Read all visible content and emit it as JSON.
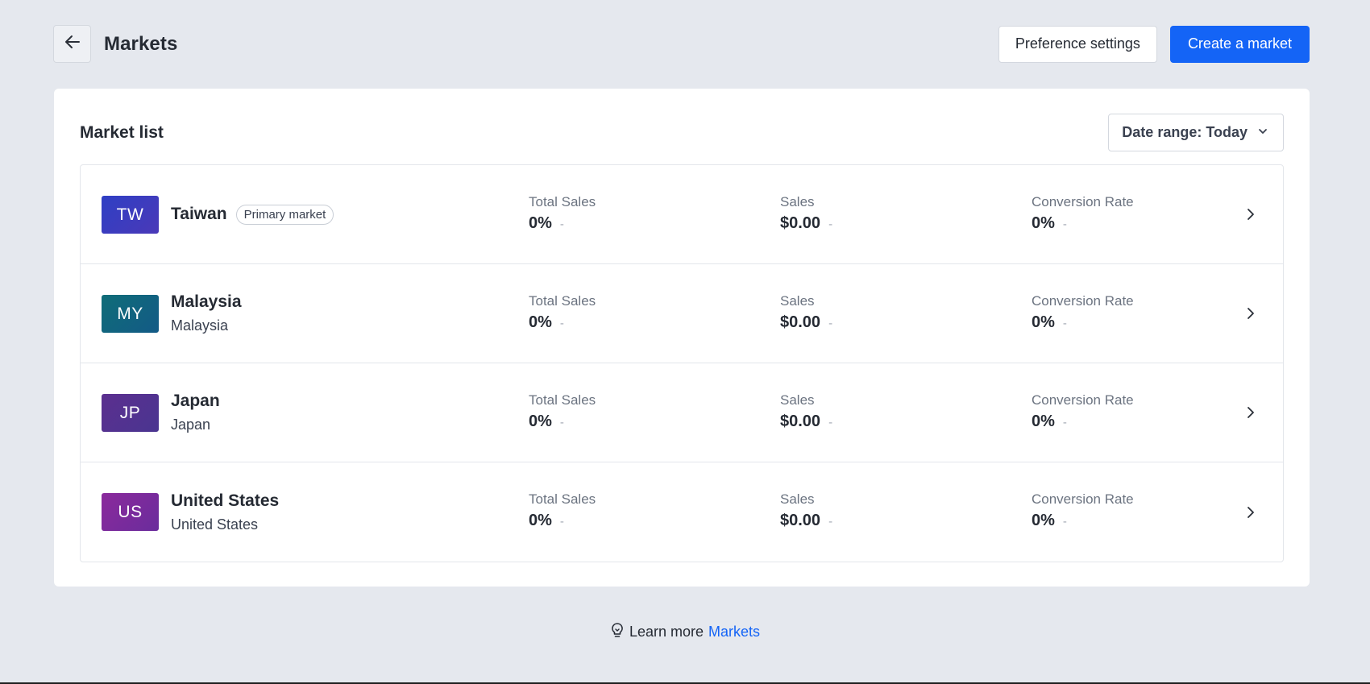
{
  "header": {
    "title": "Markets",
    "preference_label": "Preference settings",
    "create_label": "Create a market"
  },
  "card": {
    "title": "Market list",
    "date_range_label": "Date range: Today"
  },
  "metric_labels": {
    "total_sales": "Total Sales",
    "sales": "Sales",
    "conversion_rate": "Conversion Rate"
  },
  "markets": [
    {
      "code": "TW",
      "name": "Taiwan",
      "badge": "Primary market",
      "subtitle": "",
      "total_sales": "0%",
      "sales": "$0.00",
      "conversion_rate": "0%",
      "dash": "-",
      "color_from": "#2f3fc4",
      "color_to": "#4a39b8"
    },
    {
      "code": "MY",
      "name": "Malaysia",
      "badge": "",
      "subtitle": "Malaysia",
      "total_sales": "0%",
      "sales": "$0.00",
      "conversion_rate": "0%",
      "dash": "-",
      "color_from": "#0f6d78",
      "color_to": "#135a86"
    },
    {
      "code": "JP",
      "name": "Japan",
      "badge": "",
      "subtitle": "Japan",
      "total_sales": "0%",
      "sales": "$0.00",
      "conversion_rate": "0%",
      "dash": "-",
      "color_from": "#5b2f8f",
      "color_to": "#4a3590"
    },
    {
      "code": "US",
      "name": "United States",
      "badge": "",
      "subtitle": "United States",
      "total_sales": "0%",
      "sales": "$0.00",
      "conversion_rate": "0%",
      "dash": "-",
      "color_from": "#8b2a9c",
      "color_to": "#6a2c9c"
    }
  ],
  "footer": {
    "learn_text": "Learn more",
    "link_text": "Markets"
  },
  "colors": {
    "primary": "#1464f6",
    "background": "#e5e8ee"
  }
}
